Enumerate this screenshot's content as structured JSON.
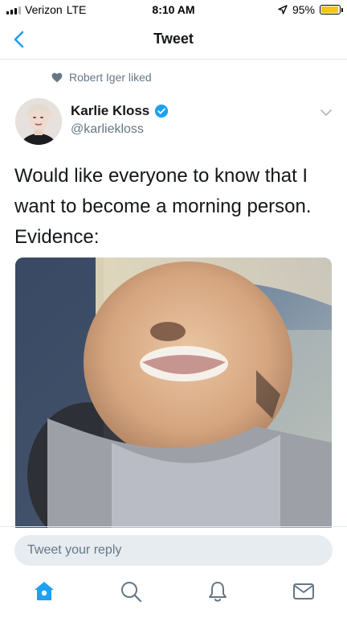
{
  "status_bar": {
    "carrier": "Verizon",
    "network": "LTE",
    "time": "8:10 AM",
    "battery": "95%",
    "battery_level": 0.95
  },
  "nav": {
    "title": "Tweet",
    "back_icon": "chevron-left-icon"
  },
  "context": {
    "text": "Robert Iger liked",
    "icon": "heart-icon"
  },
  "author": {
    "name": "Karlie Kloss",
    "handle": "@karliekloss",
    "verified": true
  },
  "tweet": {
    "text": "Would like everyone to know that I want to become a morning person. Evidence:"
  },
  "reply": {
    "placeholder": "Tweet your reply"
  },
  "tab_bar": {
    "active": "home",
    "items": [
      "home-icon",
      "search-icon",
      "notifications-bell-icon",
      "messages-envelope-icon"
    ]
  },
  "colors": {
    "accent": "#1da1f2",
    "secondary_text": "#657786",
    "divider": "#e1e8ed"
  }
}
